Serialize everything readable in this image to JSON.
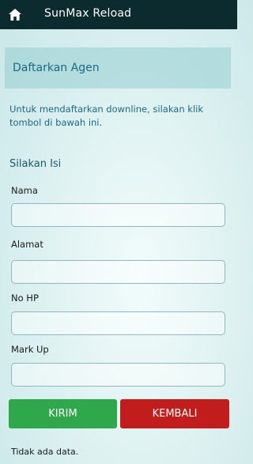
{
  "topbar": {
    "title": "SunMax Reload",
    "icon": "home-icon"
  },
  "section": {
    "title": "Daftarkan Agen"
  },
  "description": "Untuk mendaftarkan downline, silakan klik tombol di bawah ini.",
  "form": {
    "title": "Silakan Isi",
    "fields": [
      {
        "label": "Nama",
        "value": "",
        "placeholder": ""
      },
      {
        "label": "Alamat",
        "value": "",
        "placeholder": ""
      },
      {
        "label": "No HP",
        "value": "",
        "placeholder": ""
      },
      {
        "label": "Mark Up",
        "value": "",
        "placeholder": ""
      }
    ]
  },
  "buttons": {
    "submit_label": "KIRIM",
    "back_label": "KEMBALI"
  },
  "footer": {
    "note": "Tidak ada data."
  },
  "colors": {
    "topbar": "#0c2b2e",
    "accent_text": "#1a6a82",
    "submit": "#2fa84b",
    "back": "#c21d1d"
  }
}
